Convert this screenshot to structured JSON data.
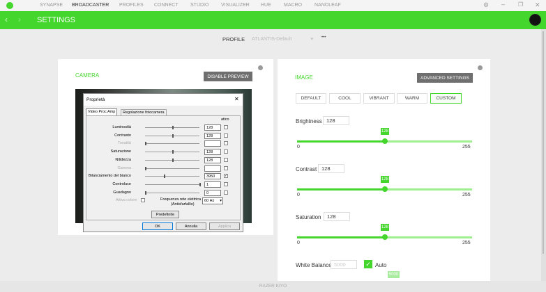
{
  "topbar": {
    "nav": [
      "SYNAPSE",
      "BROADCASTER",
      "PROFILES",
      "CONNECT",
      "STUDIO",
      "VISUALIZER",
      "HUE",
      "MACRO",
      "NANOLEAF"
    ],
    "active": "BROADCASTER"
  },
  "header": {
    "title": "SETTINGS"
  },
  "profile": {
    "label": "PROFILE",
    "value": "ATLANTIS-Default",
    "more": "•••"
  },
  "camera": {
    "title": "CAMERA",
    "disable_preview": "DISABLE PREVIEW"
  },
  "dialog": {
    "title": "Proprietà",
    "tabs": [
      "Video Proc Amp",
      "Regolazione fotocamera"
    ],
    "auto_header": "atico",
    "rows": [
      {
        "label": "Luminosità",
        "value": "128",
        "pos": 0.5,
        "enabled": true,
        "auto": false
      },
      {
        "label": "Contrasto",
        "value": "128",
        "pos": 0.5,
        "enabled": true,
        "auto": false
      },
      {
        "label": "Tonalità",
        "value": "",
        "pos": 0,
        "enabled": false,
        "auto": false
      },
      {
        "label": "Saturazione",
        "value": "128",
        "pos": 0.5,
        "enabled": true,
        "auto": false
      },
      {
        "label": "Nitidezza",
        "value": "128",
        "pos": 0.5,
        "enabled": true,
        "auto": false
      },
      {
        "label": "Gamma",
        "value": "",
        "pos": 0,
        "enabled": false,
        "auto": false
      },
      {
        "label": "Bilanciamento del bianco",
        "value": "3950",
        "pos": 0.35,
        "enabled": true,
        "auto": true
      },
      {
        "label": "Controluce",
        "value": "1",
        "pos": 1,
        "enabled": true,
        "auto": false
      },
      {
        "label": "Guadagno",
        "value": "0",
        "pos": 0,
        "enabled": true,
        "auto": false
      }
    ],
    "color_enable": "Attiva colore",
    "freq_label": "Frequenza rete elettrica",
    "freq_sub": "(Antisfarfallio)",
    "freq_value": "60 Hz",
    "defaults": "Predefinite",
    "ok": "OK",
    "cancel": "Annulla",
    "apply": "Applica"
  },
  "image": {
    "title": "IMAGE",
    "advanced": "ADVANCED SETTINGS",
    "presets": [
      "DEFAULT",
      "COOL",
      "VIBRANT",
      "WARM",
      "CUSTOM"
    ],
    "selected_preset": "CUSTOM",
    "sliders": [
      {
        "label": "Brightness",
        "value": "128",
        "min": "0",
        "max": "255"
      },
      {
        "label": "Contrast",
        "value": "128",
        "min": "0",
        "max": "255"
      },
      {
        "label": "Saturation",
        "value": "128",
        "min": "0",
        "max": "255"
      }
    ],
    "white_balance": {
      "label": "White Balance",
      "value": "5000",
      "auto_label": "Auto",
      "auto": true,
      "tip": "5000"
    }
  },
  "footer": {
    "device": "RAZER KIYO"
  },
  "colors": {
    "accent": "#44d62c"
  }
}
